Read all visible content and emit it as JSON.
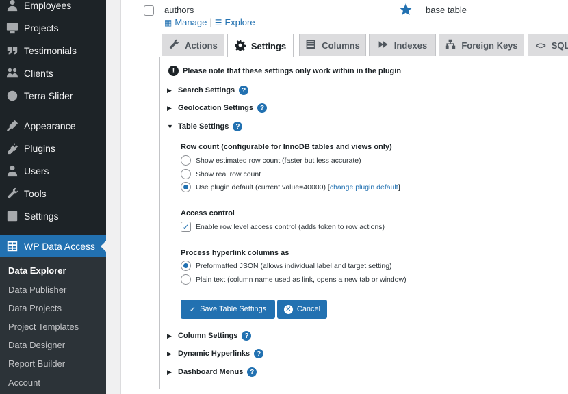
{
  "sidebar": {
    "menu": [
      {
        "label": "Employees",
        "icon": "employees-icon"
      },
      {
        "label": "Projects",
        "icon": "projects-icon"
      },
      {
        "label": "Testimonials",
        "icon": "quote-icon"
      },
      {
        "label": "Clients",
        "icon": "clients-icon"
      },
      {
        "label": "Terra Slider",
        "icon": "globe-icon"
      },
      {
        "label": "Appearance",
        "icon": "appearance-icon"
      },
      {
        "label": "Plugins",
        "icon": "plugins-icon"
      },
      {
        "label": "Users",
        "icon": "users-icon"
      },
      {
        "label": "Tools",
        "icon": "tools-icon"
      },
      {
        "label": "Settings",
        "icon": "settings-icon"
      },
      {
        "label": "WP Data Access",
        "icon": "table-icon"
      }
    ],
    "submenu": [
      "Data Explorer",
      "Data Publisher",
      "Data Projects",
      "Project Templates",
      "Data Designer",
      "Report Builder",
      "Account"
    ]
  },
  "row": {
    "table_name": "authors",
    "manage_label": "Manage",
    "explore_label": "Explore",
    "separator": "|",
    "table_type": "base table"
  },
  "tabs": [
    "Actions",
    "Settings",
    "Columns",
    "Indexes",
    "Foreign Keys",
    "SQL"
  ],
  "panel": {
    "notice": "Please note that these settings only work within in the plugin",
    "sections": {
      "search": "Search Settings",
      "geolocation": "Geolocation Settings",
      "table": "Table Settings",
      "column": "Column Settings",
      "dynamic": "Dynamic Hyperlinks",
      "dashboard": "Dashboard Menus"
    },
    "row_count": {
      "title": "Row count (configurable for InnoDB tables and views only)",
      "opt1": "Show estimated row count (faster but less accurate)",
      "opt2": "Show real row count",
      "opt3": "Use plugin default (current value=40000) [",
      "opt3_link": "change plugin default",
      "opt3_end": "]"
    },
    "access": {
      "title": "Access control",
      "opt1": "Enable row level access control (adds token to row actions)"
    },
    "hyperlink": {
      "title": "Process hyperlink columns as",
      "opt1": "Preformatted JSON (allows individual label and target setting)",
      "opt2": "Plain text (column name used as link, opens a new tab or window)"
    },
    "save_label": "Save Table Settings",
    "cancel_label": "Cancel"
  },
  "colors": {
    "accent": "#2271b1",
    "sidebar_bg": "#1d2327",
    "submenu_bg": "#2c3338"
  }
}
